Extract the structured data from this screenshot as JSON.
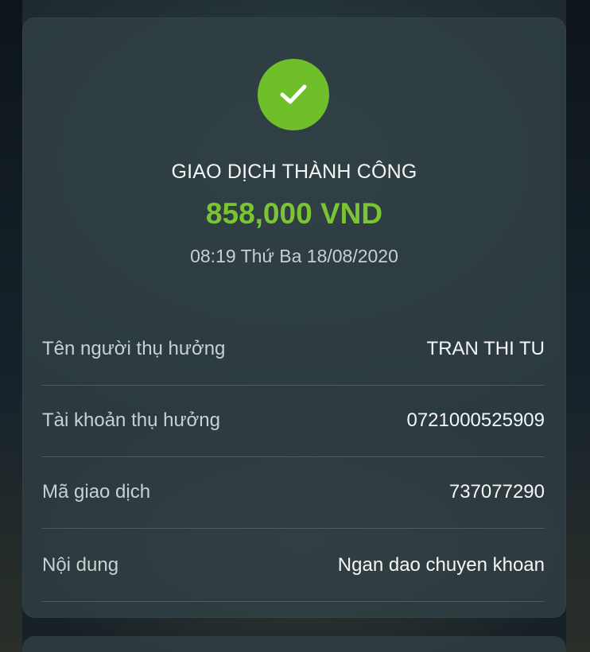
{
  "transaction": {
    "status_title": "GIAO DỊCH THÀNH CÔNG",
    "amount": "858,000 VND",
    "datetime": "08:19 Thứ Ba 18/08/2020",
    "status_icon": "check-icon",
    "accent_color": "#6fbf2b",
    "amount_color": "#7bc534"
  },
  "details": [
    {
      "label": "Tên người thụ hưởng",
      "value": "TRAN THI TU"
    },
    {
      "label": "Tài khoản thụ hưởng",
      "value": "0721000525909"
    },
    {
      "label": "Mã giao dịch",
      "value": "737077290"
    },
    {
      "label": "Nội dung",
      "value": "Ngan dao chuyen khoan"
    }
  ]
}
